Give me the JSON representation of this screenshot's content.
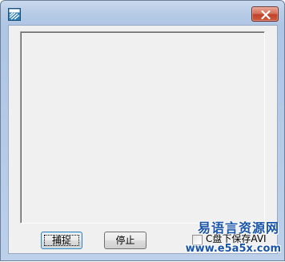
{
  "window": {
    "title": "",
    "close_icon": "close-x-icon",
    "app_icon": "app-icon"
  },
  "buttons": {
    "capture_label": "捕捉",
    "stop_label": "停止"
  },
  "checkbox": {
    "label": "C盘下保存AVI",
    "checked": false
  },
  "watermark": {
    "site_name": "易语言资源网",
    "site_url": "www.e5a5x.com"
  },
  "colors": {
    "close_button": "#c9472d",
    "watermark": "#1a55a8",
    "client_background": "#f0f0f0"
  }
}
